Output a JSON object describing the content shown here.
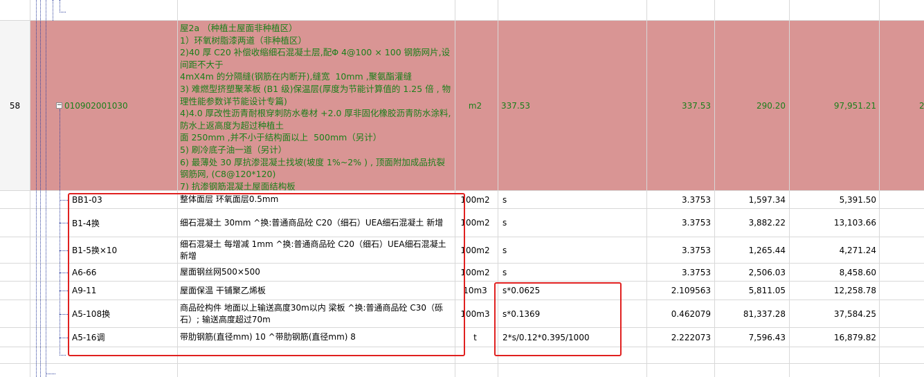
{
  "colors": {
    "highlight_row": "#d99594",
    "highlight_text": "#1a7f1a",
    "annotation_box": "#e0201f"
  },
  "parent": {
    "index": "58",
    "code": "010902001030",
    "description": "屋2a （种植土屋面非种植区）\n1）环氧树脂漆两道（非种植区）\n2)40 厚 C20 补偿收缩细石混凝土层,配Φ 4@100 × 100 钢筋网片,设间距不大于\n4mX4m 的分隔缝(钢筋在内断开),缝宽  10mm ,聚氨酯灌缝\n3) 难燃型挤塑聚苯板 (B1 级)保温层(厚度为节能计算值的 1.25 倍 , 物理性能参数详节能设计专篇)\n4)4.0 厚改性沥青耐根穿刺防水卷材 +2.0 厚非固化橡胶沥青防水涂料,防水上返高度为超过种植土\n面 250mm ,并不小于结构面以上  500mm（另计）\n5) 刷冷底子油一道（另计）\n6) 最薄处 30 厚抗渗混凝土找坡(坡度 1%~2% ) , 顶面附加成品抗裂钢筋网, (C8@120*120)\n7) 抗渗钢筋混凝土屋面结构板",
    "unit": "m2",
    "expression": "337.53",
    "quantity": "337.53",
    "price": "290.20",
    "total": "97,951.21",
    "last": "2"
  },
  "children": [
    {
      "code": "BB1-03",
      "name": "整体面层  环氧面层0.5mm",
      "unit": "100m2",
      "expression": "s",
      "quantity": "3.3753",
      "price": "1,597.34",
      "total": "5,391.50"
    },
    {
      "code": "B1-4换",
      "name": "细石混凝土  30mm  ^换:普通商品砼  C20（细石）UEA细石混凝土  新增",
      "unit": "100m2",
      "expression": "s",
      "quantity": "3.3753",
      "price": "3,882.22",
      "total": "13,103.66"
    },
    {
      "code": "B1-5换×10",
      "name": "细石混凝土  每增减  1mm  ^换:普通商品砼  C20（细石）UEA细石混凝土  新增",
      "unit": "100m2",
      "expression": "s",
      "quantity": "3.3753",
      "price": "1,265.44",
      "total": "4,271.24"
    },
    {
      "code": "A6-66",
      "name": "屋面钢丝网500×500",
      "unit": "100m2",
      "expression": "s",
      "quantity": "3.3753",
      "price": "2,506.03",
      "total": "8,458.60"
    },
    {
      "code": "A9-11",
      "name": "屋面保温  干铺聚乙烯板",
      "unit": "10m3",
      "expression": "s*0.0625",
      "quantity": "2.109563",
      "price": "5,811.05",
      "total": "12,258.78"
    },
    {
      "code": "A5-108换",
      "name": "商品砼构件  地面以上输送高度30m以内  梁板  ^换:普通商品砼  C30（砾石）; 输送高度超过70m",
      "unit": "100m3",
      "expression": "s*0.1369",
      "quantity": "0.462079",
      "price": "81,337.28",
      "total": "37,584.25"
    },
    {
      "code": "A5-16调",
      "name": "带肋钢筋(直径mm)  10  ^带肋钢筋(直径mm) 8",
      "unit": "t",
      "expression": "2*s/0.12*0.395/1000",
      "quantity": "2.222073",
      "price": "7,596.43",
      "total": "16,879.82"
    }
  ]
}
